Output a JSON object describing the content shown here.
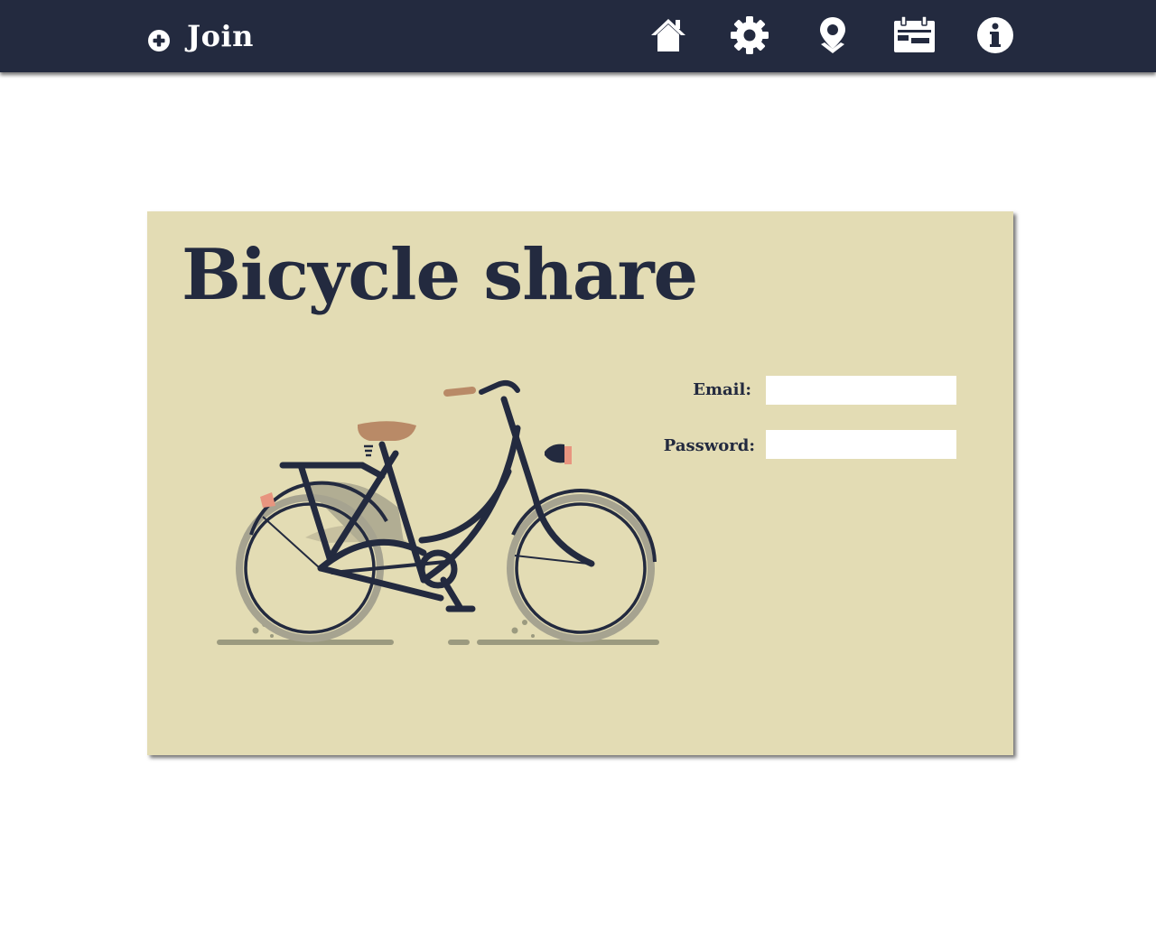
{
  "nav": {
    "join_label": "Join",
    "join_icon": "plus-circle-icon",
    "icons": [
      "home-icon",
      "gear-icon",
      "map-pin-icon",
      "calendar-icon",
      "info-icon"
    ]
  },
  "card": {
    "title": "Bicycle share",
    "illustration": "bicycle-illustration",
    "form": {
      "email_label": "Email:",
      "email_value": "",
      "email_placeholder": "",
      "password_label": "Password:",
      "password_value": "",
      "password_placeholder": ""
    }
  },
  "colors": {
    "navy": "#232a3f",
    "card_bg": "#e3dcb4",
    "saddle": "#b98a67",
    "accent": "#e8957f",
    "wheel_grey": "#9e9b8e"
  }
}
